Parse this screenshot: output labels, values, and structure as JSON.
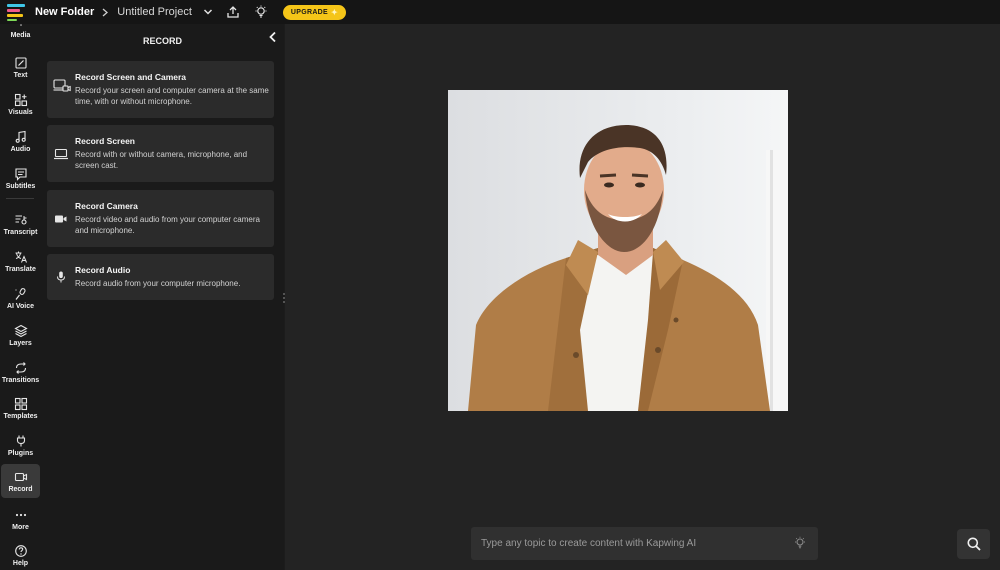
{
  "topbar": {
    "folder": "New Folder",
    "project": "Untitled Project",
    "upgrade_label": "UPGRADE",
    "upgrade_star": "✦",
    "icons": [
      "kapwing-logo-icon",
      "chevron-right-icon",
      "chevron-down-icon",
      "upload-icon",
      "lightbulb-icon"
    ]
  },
  "nav": {
    "items": [
      {
        "label": "Media",
        "icon": "media-icon"
      },
      {
        "label": "Text",
        "icon": "text-icon"
      },
      {
        "label": "Visuals",
        "icon": "visuals-icon"
      },
      {
        "label": "Audio",
        "icon": "music-note-icon"
      },
      {
        "label": "Subtitles",
        "icon": "subtitles-icon"
      },
      {
        "label": "Transcript",
        "icon": "transcript-icon"
      },
      {
        "label": "Translate",
        "icon": "translate-icon"
      },
      {
        "label": "AI Voice",
        "icon": "ai-voice-icon"
      },
      {
        "label": "Layers",
        "icon": "layers-icon"
      },
      {
        "label": "Transitions",
        "icon": "transitions-icon"
      },
      {
        "label": "Templates",
        "icon": "templates-icon"
      },
      {
        "label": "Plugins",
        "icon": "plugin-icon"
      },
      {
        "label": "Record",
        "icon": "record-icon",
        "active": true
      },
      {
        "label": "More",
        "icon": "more-icon"
      },
      {
        "label": "Help",
        "icon": "help-icon"
      }
    ]
  },
  "panel": {
    "title": "RECORD",
    "options": [
      {
        "title": "Record Screen and Camera",
        "desc": "Record your screen and computer camera at the same time, with or without microphone.",
        "icon": "screen-camera-icon"
      },
      {
        "title": "Record Screen",
        "desc": "Record with or without camera, microphone, and screen cast.",
        "icon": "laptop-icon"
      },
      {
        "title": "Record Camera",
        "desc": "Record video and audio from your computer camera and microphone.",
        "icon": "video-camera-icon"
      },
      {
        "title": "Record Audio",
        "desc": "Record audio from your computer microphone.",
        "icon": "microphone-icon"
      }
    ]
  },
  "canvas": {
    "ai_placeholder": "Type any topic to create content with Kapwing AI"
  },
  "colors": {
    "accent": "#f5c518",
    "background": "#1c1c1c",
    "panel": "#1a1a1a",
    "card": "#2b2b2b"
  }
}
